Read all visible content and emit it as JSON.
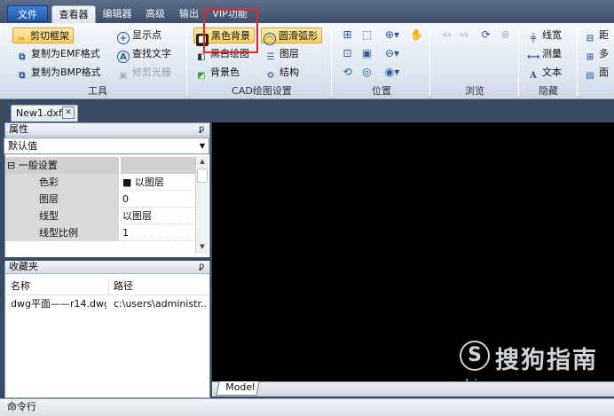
{
  "menu": {
    "file": "文件",
    "tabs": [
      "查看器",
      "编辑器",
      "高级",
      "输出",
      "VIP功能"
    ]
  },
  "ribbon": {
    "tools_group": {
      "label": "工具",
      "buttons": [
        "剪切框架",
        "显示点",
        "复制为EMF格式",
        "查找文字",
        "复制为BMP格式",
        "修剪光栅"
      ]
    },
    "cad_group": {
      "label": "CAD绘图设置",
      "buttons": [
        "黑色背景",
        "圆滑弧形",
        "黑白绘图",
        "图层",
        "背景色",
        "结构"
      ]
    },
    "position_group": {
      "label": "位置"
    },
    "browse_group": {
      "label": "浏览"
    },
    "hide_group": {
      "label": "隐藏",
      "buttons": [
        "线宽",
        "测量",
        "文本"
      ]
    },
    "right_group": {
      "buttons": [
        "距",
        "多",
        "面"
      ]
    }
  },
  "document": {
    "tab_label": "New1.dxf",
    "close_glyph": "✕"
  },
  "properties": {
    "title": "属性",
    "pin": "ᵱ",
    "combo_value": "默认值",
    "category": "⊟ 一般设置",
    "rows": [
      {
        "name": "色彩",
        "value": "■ 以图层"
      },
      {
        "name": "图层",
        "value": "0"
      },
      {
        "name": "线型",
        "value": "以图层"
      },
      {
        "name": "线型比例",
        "value": "1"
      }
    ]
  },
  "favorites": {
    "title": "收藏夹",
    "pin": "ᵱ",
    "columns": [
      "名称",
      "路径"
    ],
    "rows": [
      {
        "name": "dwg平面——r14.dwg",
        "path": "c:\\users\\administr..."
      }
    ]
  },
  "canvas": {
    "model_tab": "Model",
    "watermark_logo": "S",
    "watermark_text": "搜狗指南",
    "watermark_url": "zhinan.sogou.com"
  },
  "command_bar": {
    "label": "命令行"
  },
  "colors": {
    "accent": "#2459a8",
    "highlight": "#e8262a",
    "active": "#f8cf5e"
  }
}
